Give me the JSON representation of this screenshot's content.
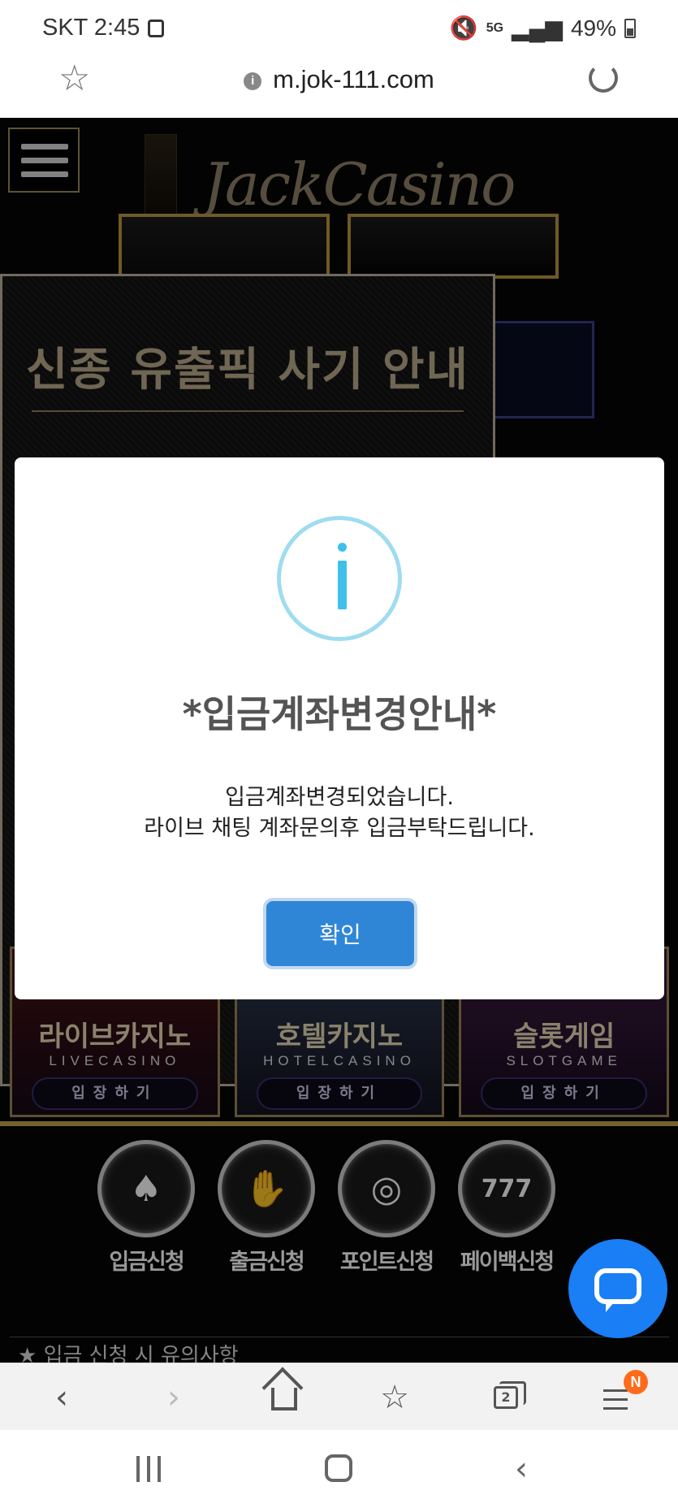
{
  "status_bar": {
    "carrier_time": "SKT 2:45",
    "network": "5G",
    "battery": "49%"
  },
  "browser": {
    "url": "m.jok-111.com"
  },
  "site": {
    "logo_text": "JackCasino",
    "notice_title": "신종 유출픽 사기 안내",
    "games": [
      {
        "title": "라이브카지노",
        "subtitle": "LIVECASINO",
        "enter_label": "입장하기"
      },
      {
        "title": "호텔카지노",
        "subtitle": "HOTELCASINO",
        "enter_label": "입장하기"
      },
      {
        "title": "슬롯게임",
        "subtitle": "SLOTGAME",
        "enter_label": "입장하기"
      }
    ],
    "actions": [
      {
        "label": "입금신청",
        "icon": "cards-icon"
      },
      {
        "label": "출금신청",
        "icon": "hand-cards-icon"
      },
      {
        "label": "포인트신청",
        "icon": "chip-icon"
      },
      {
        "label": "페이백신청",
        "icon": "slot-machine-icon"
      }
    ],
    "deposit_notice": "★ 입금 신청 시 유의사항"
  },
  "modal": {
    "title": "*입금계좌변경안내*",
    "body_line1": "입금계좌변경되었습니다.",
    "body_line2": "라이브 채팅 계좌문의후 입금부탁드립니다.",
    "confirm_label": "확인"
  },
  "toolbar": {
    "tabs_count": "2",
    "menu_badge": "N"
  },
  "colors": {
    "confirm_button": "#2f86d7",
    "info_icon": "#3fc0ea",
    "chat_bubble": "#1a7ef5",
    "gold_accent": "#c5a44f",
    "badge": "#ff6b1a"
  }
}
